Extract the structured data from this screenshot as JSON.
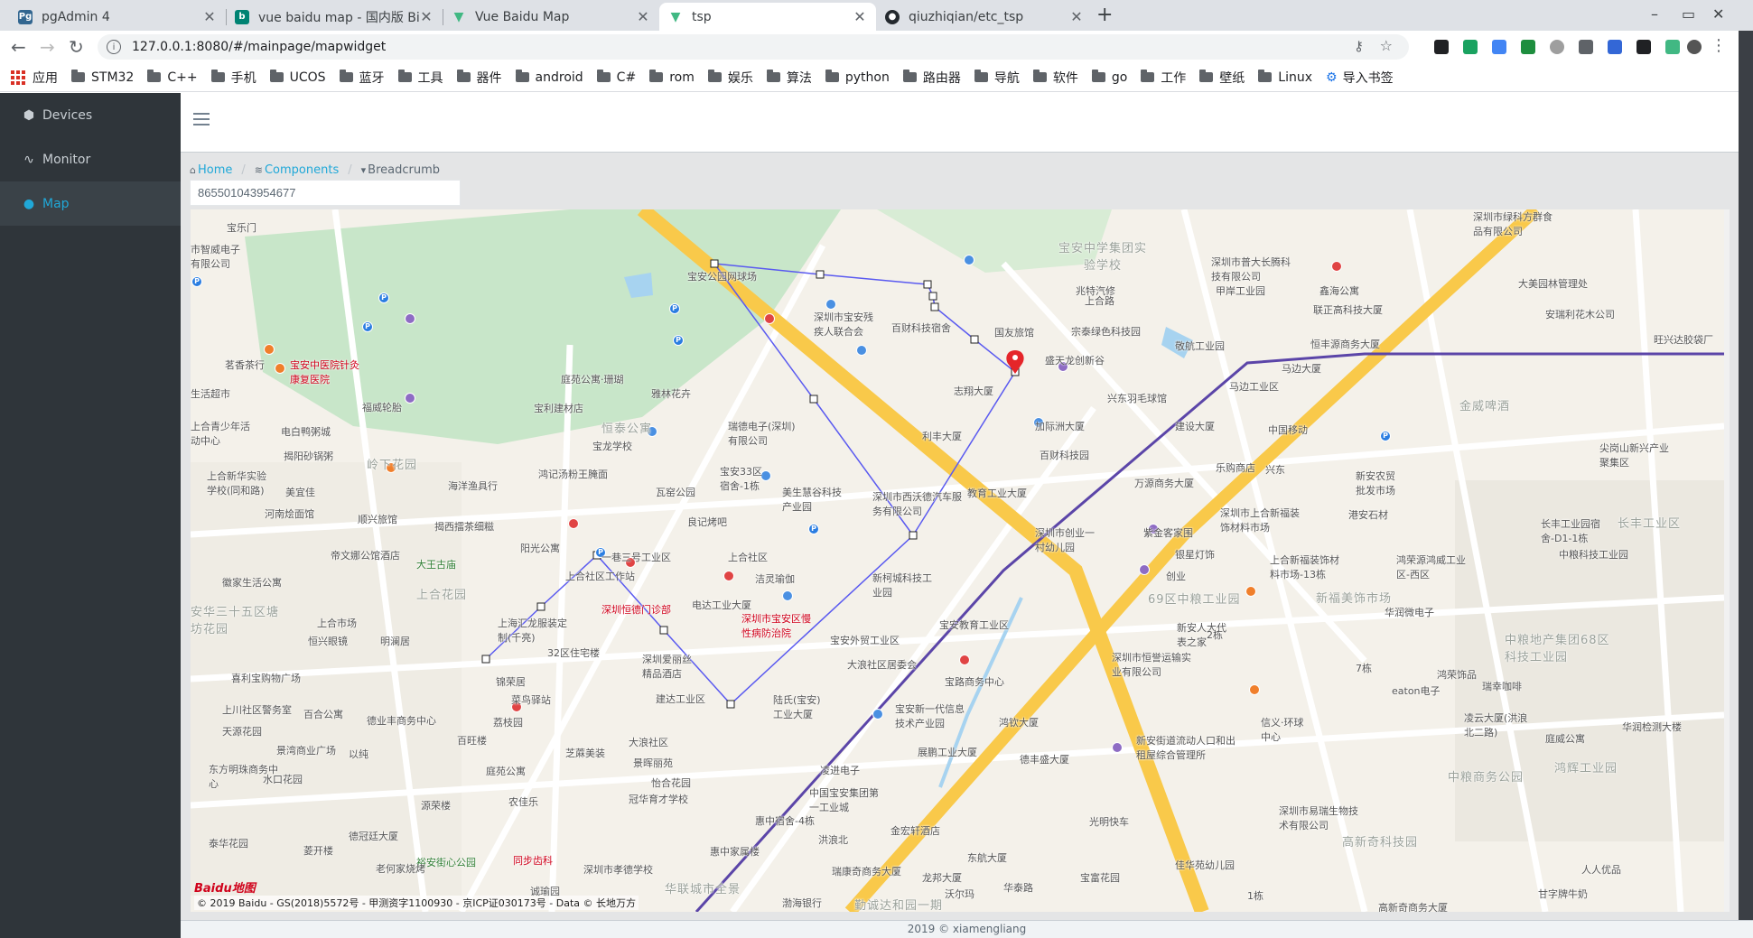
{
  "browser": {
    "tabs": [
      {
        "title": "pgAdmin 4",
        "icon": "pgadmin-icon",
        "active": false
      },
      {
        "title": "vue baidu map - 国内版 Bing",
        "icon": "bing-icon",
        "active": false
      },
      {
        "title": "Vue Baidu Map",
        "icon": "vue-icon",
        "active": false
      },
      {
        "title": "tsp",
        "icon": "vue-icon",
        "active": true
      },
      {
        "title": "qiuzhiqian/etc_tsp",
        "icon": "github-icon",
        "active": false
      }
    ],
    "url": "127.0.0.1:8080/#/mainpage/mapwidget",
    "bookmarks": [
      "应用",
      "STM32",
      "C++",
      "手机",
      "UCOS",
      "蓝牙",
      "工具",
      "器件",
      "android",
      "C#",
      "rom",
      "娱乐",
      "算法",
      "python",
      "路由器",
      "导航",
      "软件",
      "go",
      "工作",
      "壁纸",
      "Linux",
      "导入书签"
    ]
  },
  "sidebar": {
    "items": [
      {
        "label": "Devices",
        "icon": "cube-icon"
      },
      {
        "label": "Monitor",
        "icon": "pulse-icon"
      },
      {
        "label": "Map",
        "icon": "dot-icon"
      }
    ]
  },
  "breadcrumb": [
    "Home",
    "Components",
    "Breadcrumb"
  ],
  "device_input": {
    "value": "865501043954677"
  },
  "map": {
    "copyright": "© 2019 Baidu - GS(2018)5572号 - 甲测资字1100930 - 京ICP证030173号 - Data © 长地万方",
    "logo": "Baidu地图",
    "labels": [
      "宝乐门",
      "市智威电子有限公司",
      "宝安公园网球场",
      "深圳市宝安残疾人联合会",
      "宝安中学集团实验学校",
      "兆特汽修",
      "上合路",
      "深圳市普大长腾科技有限公司",
      "甲岸工业园",
      "鑫海公寓",
      "深圳市绿科方群食品有限公司",
      "大美园林管理处",
      "联正高科技大厦",
      "安瑞利花木公司",
      "旺兴达胶袋厂",
      "百财科技宿舍",
      "国友旅馆",
      "宗泰绿色科技园",
      "敬航工业园",
      "恒丰源商务大厦",
      "马边大厦",
      "宝安中医院针灸康复医院",
      "茗香茶行",
      "生活超市",
      "庭苑公寓·珊瑚",
      "雅林花卉",
      "盛天龙创新谷",
      "志翔大厦",
      "兴东羽毛球馆",
      "马边工业区",
      "建设大厦",
      "中国移动",
      "金威啤酒",
      "福威轮胎",
      "宝利建材店",
      "瑞德电子(深圳)有限公司",
      "恒泰公寓",
      "上合青少年活动中心",
      "电白鸭粥城",
      "利丰大厦",
      "加际洲大厦",
      "百财科技园",
      "乐购商店",
      "兴东",
      "尖岗山新兴产业聚集区",
      "揭阳砂锅粥",
      "岭下花园",
      "宝龙学校",
      "宝安33区宿舍-1栋",
      "万源商务大厦",
      "新安农贸批发市场",
      "上合新华实验学校(同和路)",
      "海洋渔具行",
      "鸿记汤粉王腌面",
      "美宜佳",
      "瓦窑公园",
      "美生慧谷科技产业园",
      "深圳市西沃德汽车服务有限公司",
      "教育工业大厦",
      "深圳市上合新福装饰材料市场",
      "港安石材",
      "河南烩面馆",
      "顺兴旅馆",
      "揭西擂茶细糍",
      "良记烤吧",
      "紫金客家围",
      "长丰工业区",
      "阳光公寓",
      "深圳市创业一村幼儿园",
      "银星灯饰",
      "上合新福装饰材料市场-13栋",
      "鸿荣源鸿威工业区-西区",
      "长丰工业园宿舍-D1-1栋",
      "中粮科技工业园",
      "帝文娜公馆酒店",
      "大王古庙",
      "一巷三号工业区",
      "上合社区",
      "上合社区工作站",
      "洁灵瑜伽",
      "新柯城科技工业园",
      "创业",
      "69区中粮工业园",
      "新福美饰市场",
      "华润微电子",
      "徽家生活公寓",
      "上合花园",
      "深圳恒德门诊部",
      "电达工业大厦",
      "深圳市宝安区慢性病防治院",
      "宝安外贸工业区",
      "宝安教育工业区",
      "新安人大代表之家",
      "中粮地产集团68区科技工业园",
      "安华三十五区塘坊花园",
      "上合市场",
      "恒兴眼镜",
      "明澜居",
      "上海汇龙服装定制(千亮)",
      "32区住宅楼",
      "深圳爱丽丝精品酒店",
      "大浪社区居委会",
      "宝路商务中心",
      "深圳市恒誉运输实业有限公司",
      "7栋",
      "鸿荣饰品",
      "喜利宝购物广场",
      "锦荣居",
      "菜鸟驿站",
      "建达工业区",
      "陆氏(宝安)工业大厦",
      "宝安新一代信息技术产业园",
      "鸿钦大厦",
      "新安街道流动人口和出租屋综合管理所",
      "信义·环球中心",
      "eaton电子",
      "瑞幸咖啡",
      "上川社区警务室",
      "百合公寓",
      "德业丰商务中心",
      "荔枝园",
      "百旺楼",
      "大浪社区",
      "凌云大厦(洪浪北二路)",
      "庭威公寓",
      "华润检测大楼",
      "天源花园",
      "以纯",
      "景湾商业广场",
      "东方明珠商务中心",
      "水口花园",
      "景晖丽苑",
      "怡合花园",
      "凌进电子",
      "中国宝安集团第一工业城",
      "展鹏工业大厦",
      "德丰盛大厦",
      "中粮商务公园",
      "鸿辉工业园",
      "芝蔴美装",
      "冠华育才学校",
      "庭苑公寓",
      "农佳乐",
      "源荣楼",
      "德冠廷大厦",
      "裕安街心公园",
      "同步齿科",
      "惠中宿舍-4栋",
      "洪浪北",
      "金宏轩酒店",
      "东航大厦",
      "光明快车",
      "深圳市易瑞生物技术有限公司",
      "高新奇科技园",
      "泰华花园",
      "菱开楼",
      "老何家烧烤",
      "诚瑜园",
      "深圳市孝德学校",
      "华联城市全景",
      "惠中家属楼",
      "瑞康奇商务大厦",
      "华泰路",
      "宝富花园",
      "佳华苑幼儿园",
      "人人优品",
      "渤海银行",
      "勤诚达和园一期",
      "沃尔玛",
      "龙邦大厦",
      "高新奇商务大厦",
      "甘字牌牛奶",
      "2栋",
      "1栋"
    ]
  },
  "footer": "2019 © xiamengliang"
}
